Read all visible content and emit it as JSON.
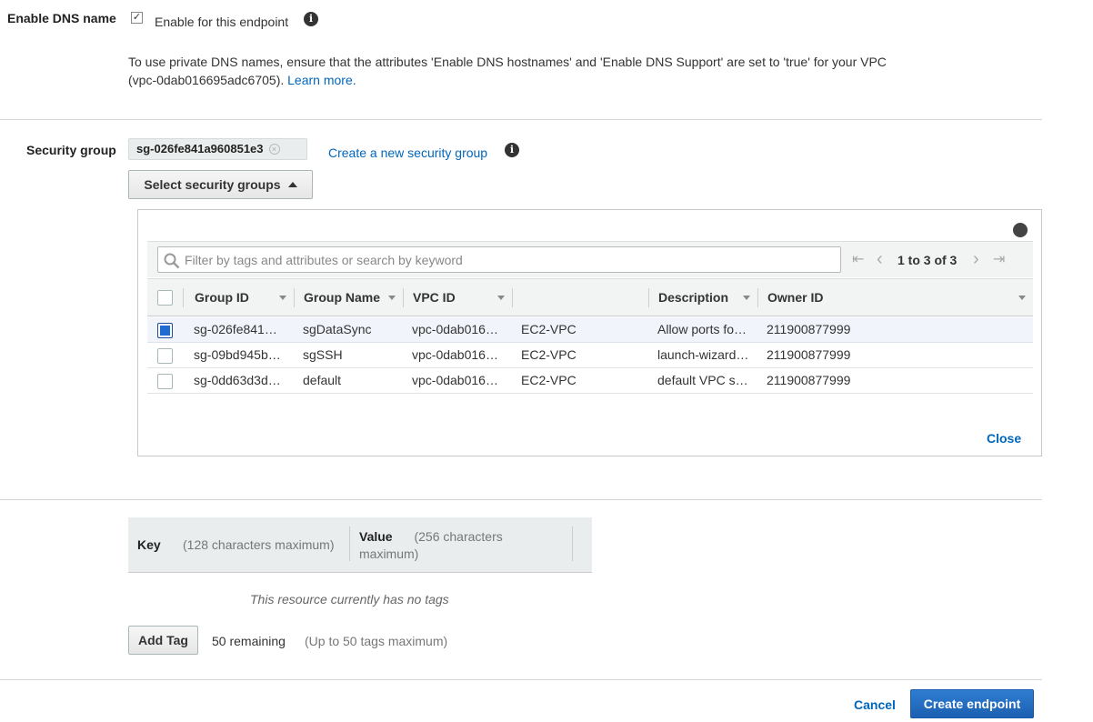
{
  "dns": {
    "label": "Enable DNS name",
    "checkbox_label": "Enable for this endpoint",
    "checked_glyph": "✓",
    "info_icon": "info-icon",
    "help_line1": "To use private DNS names, ensure that the attributes 'Enable DNS hostnames' and 'Enable DNS Support' are set to 'true' for your VPC",
    "help_line2": "(vpc-0dab016695adc6705).",
    "learn_more": "Learn more"
  },
  "security_group": {
    "label": "Security group",
    "token": "sg-026fe841a960851e3",
    "token_remove_glyph": "×",
    "create_link": "Create a new security group",
    "select_button": "Select security groups",
    "search_placeholder": "Filter by tags and attributes or search by keyword",
    "pager": {
      "text": "1 to 3 of 3",
      "first": "⇤",
      "prev": "‹",
      "next": "›",
      "last": "⇥"
    },
    "columns": [
      "Group ID",
      "Group Name",
      "VPC ID",
      "",
      "Description",
      "Owner ID"
    ],
    "rows": [
      {
        "selected": true,
        "group_id": "sg-026fe841…",
        "group_name": "sgDataSync",
        "vpc_id": "vpc-0dab016…",
        "platform": "EC2-VPC",
        "description": "Allow ports fo…",
        "owner_id": "211900877999"
      },
      {
        "selected": false,
        "group_id": "sg-09bd945b…",
        "group_name": "sgSSH",
        "vpc_id": "vpc-0dab016…",
        "platform": "EC2-VPC",
        "description": "launch-wizard…",
        "owner_id": "211900877999"
      },
      {
        "selected": false,
        "group_id": "sg-0dd63d3d…",
        "group_name": "default",
        "vpc_id": "vpc-0dab016…",
        "platform": "EC2-VPC",
        "description": "default VPC s…",
        "owner_id": "211900877999"
      }
    ],
    "close": "Close"
  },
  "tags": {
    "key_label": "Key",
    "key_hint": "(128 characters maximum)",
    "value_label": "Value",
    "value_hint_1": "(256 characters",
    "value_hint_2": "maximum)",
    "empty_message": "This resource currently has no tags",
    "add_button": "Add Tag",
    "remaining": "50 remaining",
    "limit_hint": "(Up to 50 tags maximum)"
  },
  "footer": {
    "cancel": "Cancel",
    "create": "Create endpoint"
  },
  "colors": {
    "link": "#0066bb",
    "primary_button": "#1f6ac2",
    "selected_row": "#f1f4fa"
  }
}
